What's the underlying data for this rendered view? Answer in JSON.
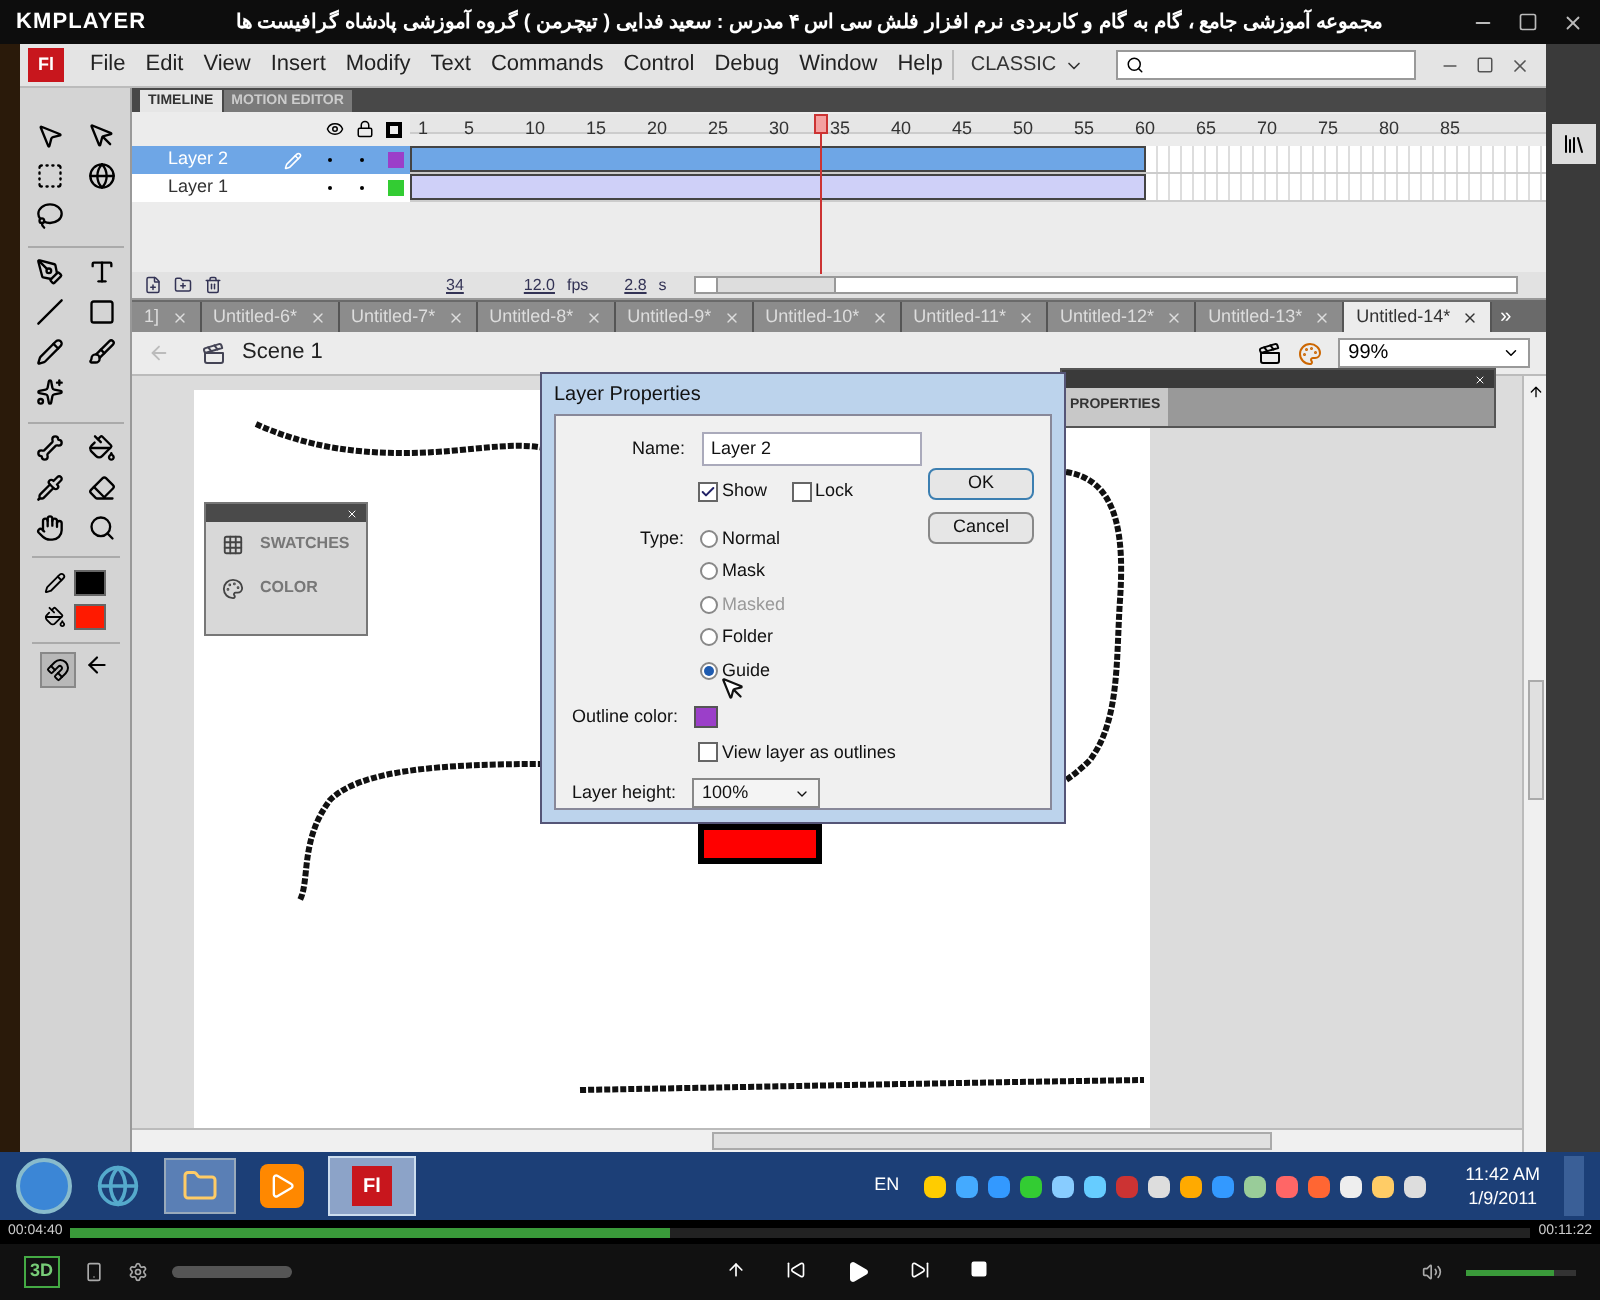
{
  "player": {
    "logo": "KMPLAYER",
    "video_title": "مجموعه آموزشی جامع ، گام به گام و کاربردی نرم افزار فلش سی اس ۴ مدرس : سعید فدایی ( تیچرمن ) گروه آموزشی پادشاه گرافیست ها",
    "seek": {
      "level": 0.41
    },
    "elapsed": "00:04:40",
    "duration": "00:11:22",
    "badge": "3D",
    "volume": {
      "level": 0.8
    }
  },
  "menu": {
    "logo": "Fl",
    "items": [
      "File",
      "Edit",
      "View",
      "Insert",
      "Modify",
      "Text",
      "Commands",
      "Control",
      "Debug",
      "Window",
      "Help"
    ],
    "workspace": "CLASSIC"
  },
  "panel_tabs": [
    {
      "label": "TIMELINE",
      "selected": true
    },
    {
      "label": "MOTION EDITOR",
      "selected": false
    }
  ],
  "timeline": {
    "frame_numbers": [
      "1",
      "5",
      "10",
      "15",
      "20",
      "25",
      "30",
      "35",
      "40",
      "45",
      "50",
      "55",
      "60",
      "65",
      "70",
      "75",
      "80",
      "85"
    ],
    "playhead": {
      "level": 0.355
    },
    "layers": [
      {
        "name": "Layer 2",
        "selected": true,
        "color": "#9b3fc9"
      },
      {
        "name": "Layer 1",
        "selected": false,
        "color": "#33cc33"
      }
    ],
    "current_frame": "34",
    "frame_rate": "12.0",
    "fps_unit": "fps",
    "elapsed": "2.8",
    "time_unit": "s"
  },
  "document_tabs": [
    {
      "label": "1]",
      "selected": false
    },
    {
      "label": "Untitled-6*",
      "selected": false
    },
    {
      "label": "Untitled-7*",
      "selected": false
    },
    {
      "label": "Untitled-8*",
      "selected": false
    },
    {
      "label": "Untitled-9*",
      "selected": false
    },
    {
      "label": "Untitled-10*",
      "selected": false
    },
    {
      "label": "Untitled-11*",
      "selected": false
    },
    {
      "label": "Untitled-12*",
      "selected": false
    },
    {
      "label": "Untitled-13*",
      "selected": false
    },
    {
      "label": "Untitled-14*",
      "selected": true
    }
  ],
  "tabs_overflow": "»",
  "scene": "Scene 1",
  "zoom": "99%",
  "swatches_panel": {
    "items": [
      {
        "label": "SWATCHES",
        "kind": "grid"
      },
      {
        "label": "COLOR",
        "kind": "palette"
      }
    ]
  },
  "properties_panel": {
    "tab": "PROPERTIES"
  },
  "dialog": {
    "title": "Layer Properties",
    "name_label": "Name:",
    "name_value": "Layer 2",
    "checks": [
      {
        "label": "Show",
        "checked": true
      },
      {
        "label": "Lock",
        "checked": false
      }
    ],
    "type_label": "Type:",
    "types": [
      {
        "label": "Normal",
        "selected": false,
        "disabled": false
      },
      {
        "label": "Mask",
        "selected": false,
        "disabled": false
      },
      {
        "label": "Masked",
        "selected": false,
        "disabled": true
      },
      {
        "label": "Folder",
        "selected": false,
        "disabled": false
      },
      {
        "label": "Guide",
        "selected": true,
        "disabled": false
      }
    ],
    "outline": {
      "label": "Outline color:",
      "color": "#9b3fc9"
    },
    "outlines_check": {
      "label": "View layer as outlines",
      "checked": false
    },
    "height_label": "Layer height:",
    "height_value": "100%",
    "buttons": [
      "OK",
      "Cancel"
    ]
  },
  "taskbar": {
    "app_button": "Fl",
    "language": "EN",
    "time": "11:42 AM",
    "date": "1/9/2011"
  }
}
